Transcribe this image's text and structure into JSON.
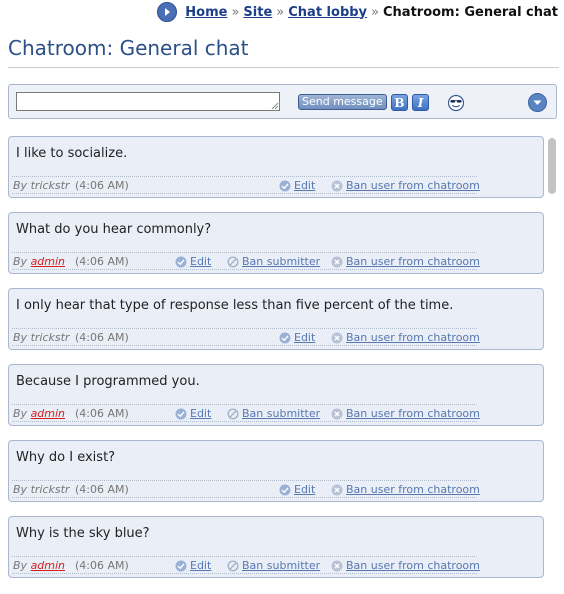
{
  "breadcrumb": {
    "items": [
      {
        "label": "Home"
      },
      {
        "label": "Site"
      },
      {
        "label": "Chat lobby"
      }
    ],
    "separator": "»",
    "current": "Chatroom: General chat"
  },
  "page_title": "Chatroom: General chat",
  "toolbar": {
    "message_value": "",
    "send_label": "Send message",
    "bold_label": "B",
    "italic_label": "I",
    "emoticon_icon": "sunglasses-smiley-icon",
    "expand_icon": "chevron-down-icon"
  },
  "messages": [
    {
      "text": "I like to socialize.",
      "by": "By",
      "author": "trickstr",
      "time": "(4:06 AM)",
      "edit": "Edit",
      "ban_user": "Ban user from chatroom"
    },
    {
      "text": "What do you hear commonly?",
      "by": "By",
      "author": "admin",
      "time": "(4:06 AM)",
      "edit": "Edit",
      "ban_submitter": "Ban submitter",
      "ban_user": "Ban user from chatroom"
    },
    {
      "text": "I only hear that type of response less than five percent of the time.",
      "by": "By",
      "author": "trickstr",
      "time": "(4:06 AM)",
      "edit": "Edit",
      "ban_user": "Ban user from chatroom"
    },
    {
      "text": "Because I programmed you.",
      "by": "By",
      "author": "admin",
      "time": "(4:06 AM)",
      "edit": "Edit",
      "ban_submitter": "Ban submitter",
      "ban_user": "Ban user from chatroom"
    },
    {
      "text": "Why do I exist?",
      "by": "By",
      "author": "trickstr",
      "time": "(4:06 AM)",
      "edit": "Edit",
      "ban_user": "Ban user from chatroom"
    },
    {
      "text": "Why is the sky blue?",
      "by": "By",
      "author": "admin",
      "time": "(4:06 AM)",
      "edit": "Edit",
      "ban_submitter": "Ban submitter",
      "ban_user": "Ban user from chatroom"
    }
  ],
  "colors": {
    "title": "#2c4f86",
    "link": "#1d3f8a",
    "admin_author": "#d32020",
    "message_bg": "#e9eef7",
    "message_border": "#aab8cf"
  }
}
